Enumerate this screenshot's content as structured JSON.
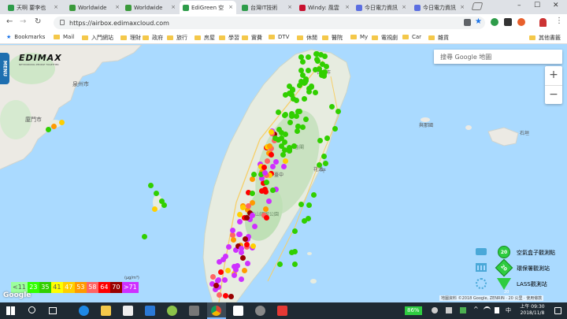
{
  "browser": {
    "tabs": [
      {
        "label": "天啊 要李也",
        "color": "#2e9c4a",
        "active": false
      },
      {
        "label": "Worldwide",
        "color": "#3a9a3a",
        "active": false
      },
      {
        "label": "Worldwide",
        "color": "#3a9a3a",
        "active": false
      },
      {
        "label": "EdiGreen 空",
        "color": "#2e9c4a",
        "active": true
      },
      {
        "label": "台灣IT技術",
        "color": "#2e9c4a",
        "active": false
      },
      {
        "label": "Windy: 風雲",
        "color": "#c8102e",
        "active": false
      },
      {
        "label": "今日電力資訊",
        "color": "#5b6ee1",
        "active": false
      },
      {
        "label": "今日電力資訊",
        "color": "#5b6ee1",
        "active": false
      }
    ],
    "window_controls": {
      "minimize": "–",
      "maximize": "☐",
      "close": "✕"
    },
    "url": "https://airbox.edimaxcloud.com",
    "bookmarks_label": "Bookmarks",
    "bookmark_folders": [
      "Mail",
      "入門網站",
      "理財",
      "政府",
      "旅行",
      "房屋",
      "學習",
      "實費",
      "DTV",
      "休閒",
      "醫院",
      "My",
      "電視劇",
      "Car",
      "雜貨"
    ],
    "other_bookmarks": "其他書籤"
  },
  "map": {
    "search_placeholder": "搜尋 Google 地圖",
    "menu_label": "MENU",
    "logo": "EDIMAX",
    "logo_tagline": "NETWORKING PEOPLE TOGETHER",
    "zoom_in": "+",
    "zoom_out": "−",
    "google": "Google",
    "attribution": "地圖資料 ©2018 Google, ZENRIN · 20 公里 · 使用條款",
    "place_labels": [
      {
        "text": "泉州市"
      },
      {
        "text": "廈門市"
      },
      {
        "text": "台北市"
      },
      {
        "text": "石垣"
      },
      {
        "text": "太魯閣"
      },
      {
        "text": "玉山國家公園"
      },
      {
        "text": "臺中"
      },
      {
        "text": "花蓮"
      },
      {
        "text": "與那國"
      },
      {
        "text": "平"
      }
    ],
    "legend_unit": "(μg/m³)",
    "legend": [
      {
        "label": "<11",
        "color": "#9cff9c"
      },
      {
        "label": "23",
        "color": "#31ff00"
      },
      {
        "label": "35",
        "color": "#31cf00"
      },
      {
        "label": "41",
        "color": "#ffff00"
      },
      {
        "label": "47",
        "color": "#ffcf00"
      },
      {
        "label": "53",
        "color": "#ff9a00"
      },
      {
        "label": "58",
        "color": "#ff6464"
      },
      {
        "label": "64",
        "color": "#ff0000"
      },
      {
        "label": "70",
        "color": "#990000"
      },
      {
        "label": ">71",
        "color": "#ce30ff"
      }
    ],
    "station_types": [
      {
        "label": "空氣盒子觀測點",
        "icon": "airbox-icon",
        "value": "20"
      },
      {
        "label": "環保署觀測站",
        "icon": "epa-station-icon",
        "value": "20"
      },
      {
        "label": "LASS觀測站",
        "icon": "lass-icon",
        "value": "20"
      }
    ]
  },
  "taskbar": {
    "battery": "86%",
    "time": "上午 09:30",
    "date": "2018/11/8"
  }
}
